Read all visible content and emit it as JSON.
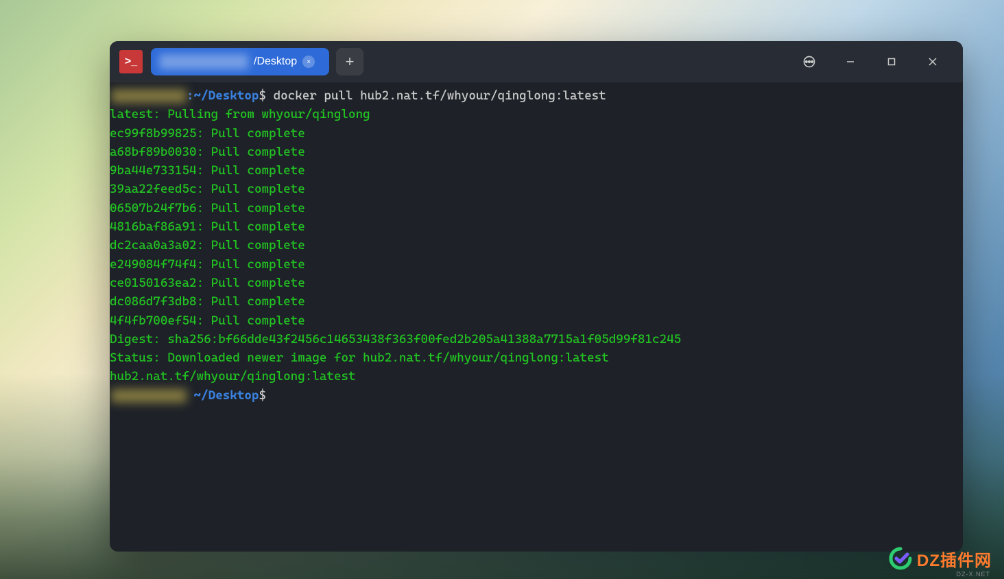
{
  "tab": {
    "title": "/Desktop",
    "close_glyph": "×"
  },
  "newtab": {
    "glyph": "+"
  },
  "prompt1": {
    "path": ":~/Desktop",
    "dollar": "$",
    "command": " docker pull hub2.nat.tf/whyour/qinglong:latest"
  },
  "output": {
    "lines": [
      "latest: Pulling from whyour/qinglong",
      "ec99f8b99825: Pull complete",
      "a68bf89b0030: Pull complete",
      "9ba44e733154: Pull complete",
      "39aa22feed5c: Pull complete",
      "06507b24f7b6: Pull complete",
      "4816baf86a91: Pull complete",
      "dc2caa0a3a02: Pull complete",
      "e249084f74f4: Pull complete",
      "ce0150163ea2: Pull complete",
      "dc086d7f3db8: Pull complete",
      "4f4fb700ef54: Pull complete",
      "Digest: sha256:bf66dde43f2456c14653438f363f00fed2b205a41388a7715a1f05d99f81c245",
      "Status: Downloaded newer image for hub2.nat.tf/whyour/qinglong:latest",
      "hub2.nat.tf/whyour/qinglong:latest"
    ]
  },
  "prompt2": {
    "path": " ~/Desktop",
    "dollar": "$"
  },
  "watermark": {
    "text": "DZ插件网",
    "sub": "DZ-X.NET"
  },
  "app_icon": {
    "glyph": ">_"
  }
}
